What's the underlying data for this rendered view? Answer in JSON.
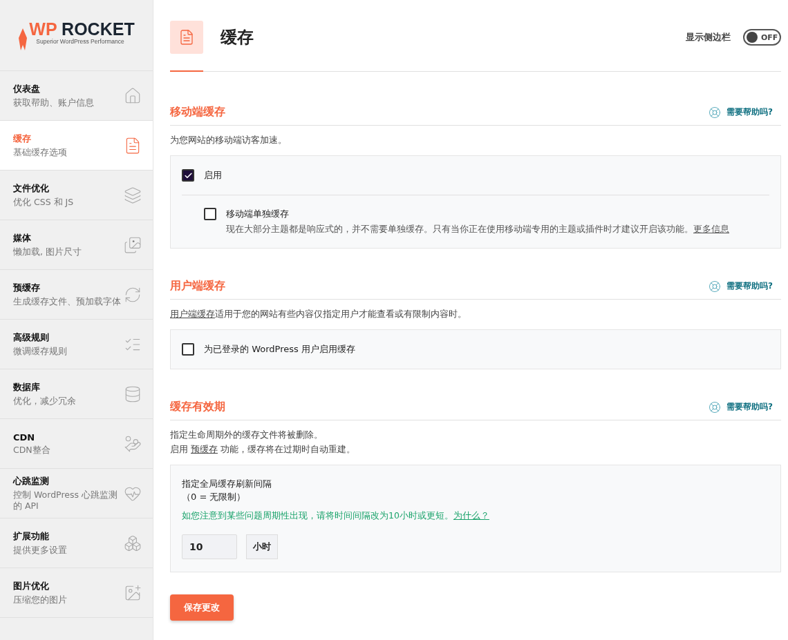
{
  "logo": {
    "brand_accent": "WP",
    "brand": "ROCKET",
    "tagline": "Superior WordPress Performance"
  },
  "sidebar": {
    "items": [
      {
        "title": "仪表盘",
        "subtitle": "获取帮助、账户信息",
        "selected": false
      },
      {
        "title": "缓存",
        "subtitle": "基础缓存选项",
        "selected": true
      },
      {
        "title": "文件优化",
        "subtitle": "优化 CSS 和 JS",
        "selected": false
      },
      {
        "title": "媒体",
        "subtitle": "懒加载, 图片尺寸",
        "selected": false
      },
      {
        "title": "预缓存",
        "subtitle": "生成缓存文件、预加载字体",
        "selected": false
      },
      {
        "title": "高级规则",
        "subtitle": "微调缓存规则",
        "selected": false
      },
      {
        "title": "数据库",
        "subtitle": "优化，减少冗余",
        "selected": false
      },
      {
        "title": "CDN",
        "subtitle": "CDN整合",
        "selected": false
      },
      {
        "title": "心跳监测",
        "subtitle": "控制 WordPress 心跳监测的 API",
        "selected": false
      },
      {
        "title": "扩展功能",
        "subtitle": "提供更多设置",
        "selected": false
      },
      {
        "title": "图片优化",
        "subtitle": "压缩您的图片",
        "selected": false
      }
    ]
  },
  "header": {
    "title": "缓存",
    "sidebar_toggle": {
      "label": "显示侧边栏",
      "on": false,
      "state_text": "OFF"
    }
  },
  "sections": [
    {
      "title": "移动端缓存",
      "help": "需要帮助吗?",
      "description": [
        [
          {
            "text": "为您网站的移动端访客加速。",
            "link": false
          }
        ]
      ],
      "options": [
        {
          "kind": "checkbox",
          "label": "启用",
          "checked": true
        },
        {
          "kind": "sub_checkbox",
          "label": "移动端单独缓存",
          "checked": false,
          "note": [
            {
              "text": "现在大部分主题都是响应式的，并不需要单独缓存。只有当你正在使用移动端专用的主题或插件时才建议开启该功能。",
              "link": false
            },
            {
              "text": "更多信息",
              "link": true
            }
          ]
        }
      ]
    },
    {
      "title": "用户端缓存",
      "help": "需要帮助吗?",
      "description": [
        [
          {
            "text": "用户端缓存",
            "link": true
          },
          {
            "text": "适用于您的网站有些内容仅指定用户才能查看或有限制内容时。",
            "link": false
          }
        ]
      ],
      "options": [
        {
          "kind": "checkbox",
          "label": "为已登录的 WordPress 用户启用缓存",
          "checked": false
        }
      ]
    },
    {
      "title": "缓存有效期",
      "help": "需要帮助吗?",
      "description": [
        [
          {
            "text": "指定生命周期外的缓存文件将被删除。",
            "link": false
          }
        ],
        [
          {
            "text": "启用 ",
            "link": false
          },
          {
            "text": "预缓存",
            "link": true
          },
          {
            "text": " 功能，缓存将在过期时自动重建。",
            "link": false
          }
        ]
      ],
      "options": [
        {
          "kind": "interval",
          "label": "指定全局缓存刷新间隔",
          "hint": "（0 = 无限制）",
          "warning": [
            {
              "text": "如您注意到某些问题周期性出现，请将时间间隔改为10小时或更短。",
              "link": false
            },
            {
              "text": "为什么？ ",
              "link": true
            }
          ],
          "value": "10",
          "unit": "小时"
        }
      ]
    }
  ],
  "save_button": "保存更改"
}
